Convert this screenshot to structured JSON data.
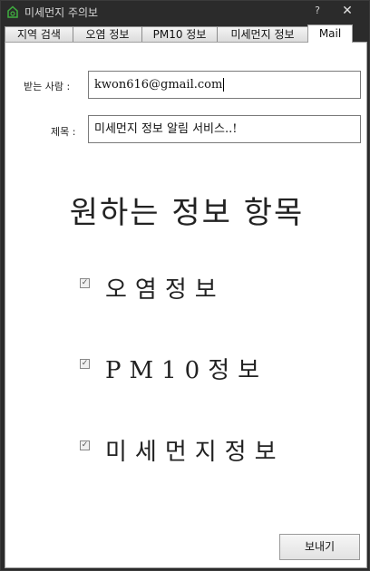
{
  "window": {
    "title": "미세먼지 주의보",
    "help_label": "?",
    "close_label": "✕"
  },
  "tabs": [
    {
      "label": "지역 검색"
    },
    {
      "label": "오염 정보"
    },
    {
      "label": "PM10 정보"
    },
    {
      "label": "미세먼지 정보"
    },
    {
      "label": "Mail",
      "active": true
    }
  ],
  "mail": {
    "recipient_label": "받는 사람 :",
    "recipient_value": "kwon616@gmail.com",
    "subject_label": "제목 :",
    "subject_value": "미세먼지 정보 알림 서비스..!",
    "heading": "원하는 정보 항목",
    "options": [
      {
        "label": "오염정보",
        "checked": true
      },
      {
        "label": "PM10정보",
        "checked": true
      },
      {
        "label": "미세먼지정보",
        "checked": true
      }
    ],
    "send_label": "보내기"
  },
  "colors": {
    "titlebar": "#2b2b2b",
    "panel": "#ffffff",
    "text": "#222222"
  }
}
